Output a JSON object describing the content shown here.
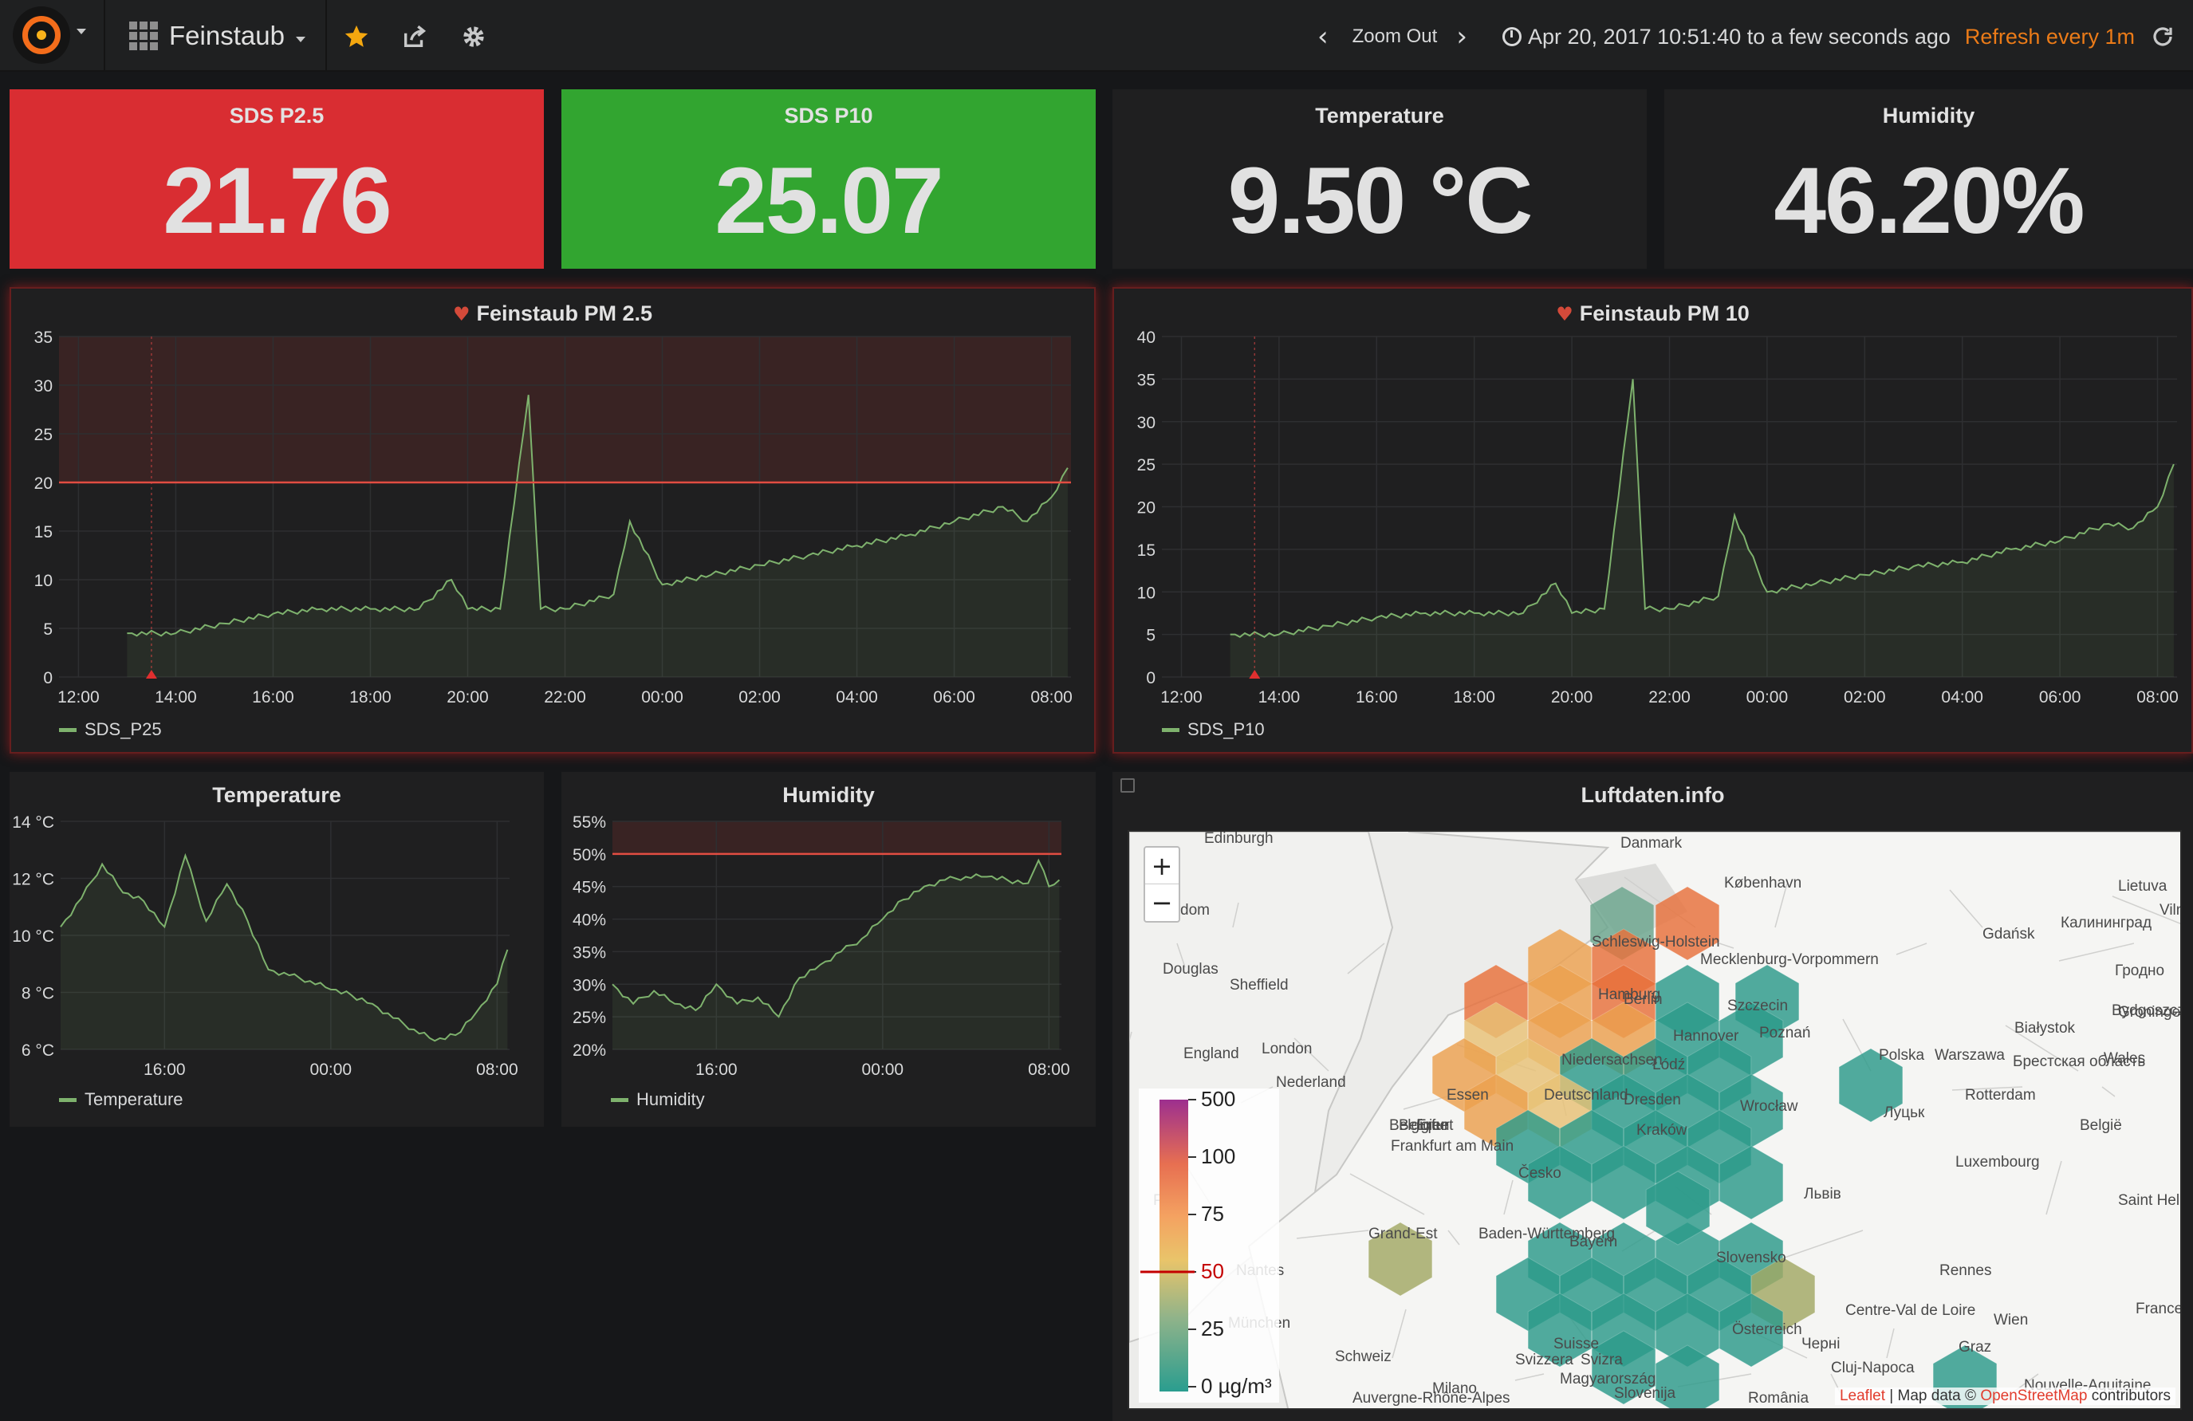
{
  "navbar": {
    "dashboard_title": "Feinstaub",
    "zoom_out_label": "Zoom Out",
    "time_range": "Apr 20, 2017 10:51:40 to a few seconds ago",
    "refresh_label": "Refresh every 1m"
  },
  "stats": [
    {
      "title": "SDS P2.5",
      "value": "21.76",
      "color": "#d92d32"
    },
    {
      "title": "SDS P10",
      "value": "25.07",
      "color": "#32a530"
    },
    {
      "title": "Temperature",
      "value": "9.50 °C"
    },
    {
      "title": "Humidity",
      "value": "46.20%"
    }
  ],
  "graphs": {
    "pm25": {
      "title": "Feinstaub PM 2.5",
      "legend": "SDS_P25"
    },
    "pm10": {
      "title": "Feinstaub PM 10",
      "legend": "SDS_P10"
    },
    "temperature": {
      "title": "Temperature",
      "legend": "Temperature"
    },
    "humidity": {
      "title": "Humidity",
      "legend": "Humidity"
    }
  },
  "map": {
    "title": "Luftdaten.info",
    "zoom_in": "+",
    "zoom_out": "−",
    "attribution_leaflet": "Leaflet",
    "attribution_mid": " | Map data © ",
    "attribution_osm": "OpenStreetMap",
    "attribution_end": " contributors",
    "legend_labels": [
      "500",
      "100",
      "75",
      "50",
      "25",
      "0 µg/m³"
    ],
    "place_labels": [
      "Edinburgh",
      "Danmark",
      "København",
      "Lietuva",
      "Vilnius",
      "Gdańsk",
      "Калининград",
      "Гродно",
      "Kingdom",
      "Douglas",
      "Sheffield",
      "Schleswig-Holstein",
      "Mecklenburg-Vorpommern",
      "Szczecin",
      "Bydgoszcz",
      "Białystok",
      "Groningen",
      "Hamburg",
      "Berlin",
      "Poznań",
      "Polska",
      "Warszawa",
      "Брестская область",
      "Wales",
      "England",
      "London",
      "Nederland",
      "Niedersachsen",
      "Hannover",
      "Łódź",
      "Rotterdam",
      "Essen",
      "Deutschland",
      "Dresden",
      "Wrocław",
      "Луцьк",
      "België",
      "Belgique",
      "Belgien",
      "Erfurt",
      "Frankfurt am Main",
      "Kraków",
      "Luxembourg",
      "Česko",
      "Львів",
      "Saint Helier",
      "Paris",
      "Grand-Est",
      "Baden-Württemberg",
      "Bayern",
      "Slovensko",
      "Rennes",
      "Wien",
      "Nantes",
      "Centre-Val de Loire",
      "München",
      "Österreich",
      "Черні",
      "France",
      "Schweiz",
      "Suisse",
      "Svizzera",
      "Svizra",
      "Magyarország",
      "Graz",
      "Cluj-Napoca",
      "Nouvelle-Aquitaine",
      "Auvergne-Rhône-Alpes",
      "Milano",
      "Slovenija",
      "România"
    ]
  },
  "chart_data": [
    {
      "type": "line",
      "title": "Feinstaub PM 2.5",
      "series": [
        {
          "name": "SDS_P25",
          "x": [
            "13:00",
            "14:00",
            "15:00",
            "16:00",
            "17:00",
            "18:00",
            "19:00",
            "19:40",
            "20:00",
            "20:40",
            "21:15",
            "21:30",
            "22:00",
            "23:00",
            "23:20",
            "00:00",
            "01:00",
            "02:00",
            "03:00",
            "04:00",
            "05:00",
            "06:00",
            "07:00",
            "07:30",
            "08:00",
            "08:20"
          ],
          "y": [
            4.5,
            4.5,
            5.5,
            6.5,
            7,
            7,
            7,
            10,
            7,
            7,
            29,
            7,
            7,
            8.5,
            16,
            9.5,
            10.5,
            11.5,
            12.5,
            13.5,
            14.5,
            16,
            17.5,
            16,
            18.5,
            21.5
          ]
        }
      ],
      "x_ticks": [
        "12:00",
        "14:00",
        "16:00",
        "18:00",
        "20:00",
        "22:00",
        "00:00",
        "02:00",
        "04:00",
        "06:00",
        "08:00"
      ],
      "ylim": [
        0,
        35
      ],
      "y_ticks": [
        0,
        5,
        10,
        15,
        20,
        25,
        30,
        35
      ],
      "threshold": 20
    },
    {
      "type": "line",
      "title": "Feinstaub PM 10",
      "series": [
        {
          "name": "SDS_P10",
          "x": [
            "13:00",
            "14:00",
            "15:00",
            "16:00",
            "17:00",
            "18:00",
            "19:00",
            "19:40",
            "20:00",
            "20:40",
            "21:15",
            "21:30",
            "22:00",
            "23:00",
            "23:20",
            "00:00",
            "01:00",
            "02:00",
            "03:00",
            "04:00",
            "05:00",
            "06:00",
            "07:00",
            "07:30",
            "08:00",
            "08:20"
          ],
          "y": [
            5,
            5,
            6,
            7,
            7.5,
            7.5,
            7.5,
            11,
            7.5,
            8,
            35,
            8,
            8,
            9.5,
            19,
            10,
            11,
            12,
            13,
            13.5,
            15,
            16,
            18,
            17.5,
            20,
            25
          ]
        }
      ],
      "x_ticks": [
        "12:00",
        "14:00",
        "16:00",
        "18:00",
        "20:00",
        "22:00",
        "00:00",
        "02:00",
        "04:00",
        "06:00",
        "08:00"
      ],
      "ylim": [
        0,
        40
      ],
      "y_ticks": [
        0,
        5,
        10,
        15,
        20,
        25,
        30,
        35,
        40
      ]
    },
    {
      "type": "line",
      "title": "Temperature",
      "series": [
        {
          "name": "Temperature",
          "x": [
            "11:00",
            "12:00",
            "13:00",
            "14:00",
            "15:00",
            "16:00",
            "17:00",
            "18:00",
            "19:00",
            "20:00",
            "21:00",
            "22:00",
            "23:00",
            "00:00",
            "01:00",
            "02:00",
            "03:00",
            "04:00",
            "05:00",
            "06:00",
            "07:00",
            "08:00",
            "08:30"
          ],
          "y": [
            10.3,
            11.3,
            12.5,
            11.5,
            11.2,
            10.3,
            12.8,
            10.5,
            11.8,
            10.5,
            8.8,
            8.6,
            8.4,
            8.1,
            7.9,
            7.6,
            7.1,
            6.7,
            6.3,
            6.5,
            7.3,
            8.3,
            9.5
          ]
        }
      ],
      "x_ticks": [
        "16:00",
        "00:00",
        "08:00"
      ],
      "ylim": [
        6,
        14
      ],
      "y_ticks": [
        "6 °C",
        "8 °C",
        "10 °C",
        "12 °C",
        "14 °C"
      ]
    },
    {
      "type": "line",
      "title": "Humidity",
      "series": [
        {
          "name": "Humidity",
          "x": [
            "11:00",
            "12:00",
            "13:00",
            "14:00",
            "15:00",
            "16:00",
            "17:00",
            "18:00",
            "19:00",
            "20:00",
            "21:00",
            "22:00",
            "23:00",
            "00:00",
            "01:00",
            "02:00",
            "03:00",
            "04:00",
            "05:00",
            "06:00",
            "07:00",
            "07:30",
            "08:00",
            "08:30"
          ],
          "y": [
            30,
            27,
            29,
            27,
            26,
            30,
            27,
            28,
            25,
            31,
            33,
            35,
            37,
            40,
            43,
            45,
            46,
            46.5,
            46.5,
            46,
            45.5,
            49,
            45,
            46
          ]
        }
      ],
      "x_ticks": [
        "16:00",
        "00:00",
        "08:00"
      ],
      "ylim": [
        20,
        55
      ],
      "y_ticks": [
        "20%",
        "25%",
        "30%",
        "35%",
        "40%",
        "45%",
        "50%",
        "55%"
      ],
      "threshold": 50
    }
  ],
  "colors": {
    "series_green": "#7eb26d",
    "threshold_red": "#e24d42",
    "refresh_orange": "#eb7b18",
    "star": "#f4a70f"
  }
}
